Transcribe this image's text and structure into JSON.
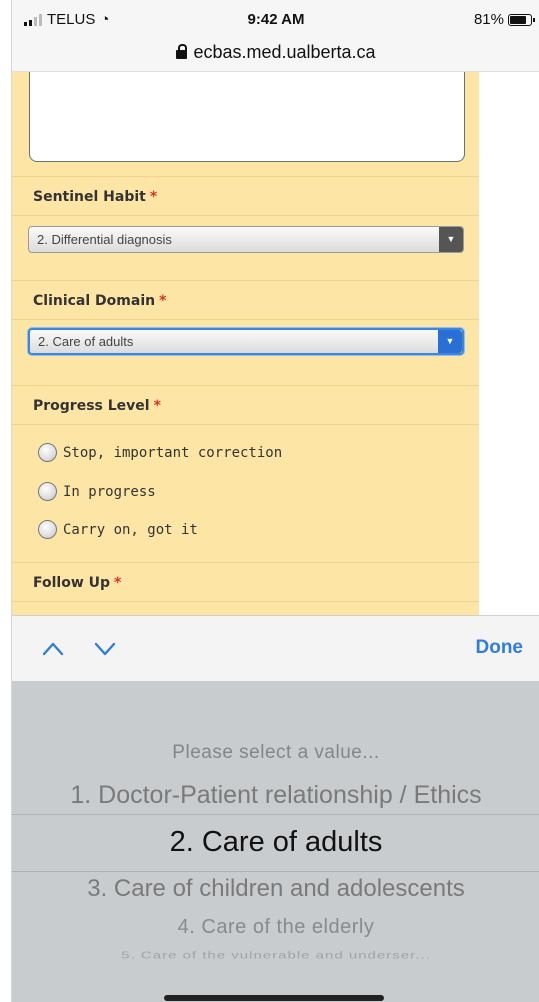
{
  "status_bar": {
    "carrier": "TELUS",
    "time": "9:42 AM",
    "battery": "81%"
  },
  "url_bar": {
    "domain": "ecbas.med.ualberta.ca"
  },
  "form": {
    "required_marker": "*",
    "sentinel_habit": {
      "label": "Sentinel Habit",
      "selected": "2. Differential diagnosis"
    },
    "clinical_domain": {
      "label": "Clinical Domain",
      "selected": "2. Care of adults"
    },
    "progress_level": {
      "label": "Progress Level",
      "options": [
        "Stop, important correction",
        "In progress",
        "Carry on, got it"
      ]
    },
    "follow_up": {
      "label": "Follow Up"
    }
  },
  "accessory": {
    "done_label": "Done"
  },
  "picker": {
    "options": [
      "Please select a value...",
      "1. Doctor-Patient relationship / Ethics",
      "2. Care of adults",
      "3. Care of children and adolescents",
      "4. Care of the elderly",
      "5. Care of the vulnerable and underser..."
    ],
    "selected_index": 2
  },
  "colors": {
    "form_background": "#fde6a5",
    "accent_blue": "#2f7ed8",
    "required_red": "#e03020",
    "picker_background": "#c9ccce"
  },
  "icons": {
    "signal": "signal-bars-icon",
    "wifi": "wifi-icon",
    "battery": "battery-icon",
    "lock": "lock-icon",
    "previous": "chevron-up-icon",
    "next": "chevron-down-icon",
    "dropdown": "dropdown-arrow-icon",
    "radio": "radio-button-icon"
  }
}
